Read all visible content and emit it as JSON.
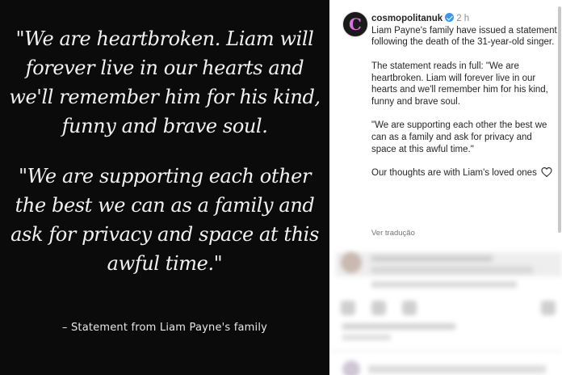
{
  "image": {
    "quote_1": "\"We are heartbroken. Liam will forever live in our hearts and we'll remember him for his kind, funny and brave soul.",
    "quote_2": "\"We are supporting each other the best we can as a family and ask for privacy and space at this awful time.\"",
    "attribution": "– Statement from Liam Payne's family"
  },
  "post": {
    "avatar_letter": "C",
    "username": "cosmopolitanuk",
    "time": "2 h",
    "caption_intro": "Liam Payne's family have issued a statement following the death of the 31-year-old singer.",
    "caption_para_2": "The statement reads in full: \"We are heartbroken. Liam will forever live in our hearts and we'll remember him for his kind, funny and brave soul.",
    "caption_para_3": "\"We are supporting each other the best we can as a family and ask for privacy and space at this awful time.\"",
    "caption_para_4": "Our thoughts are with Liam's loved ones",
    "see_translation": "Ver tradução",
    "accent_color": "#3897f0"
  }
}
